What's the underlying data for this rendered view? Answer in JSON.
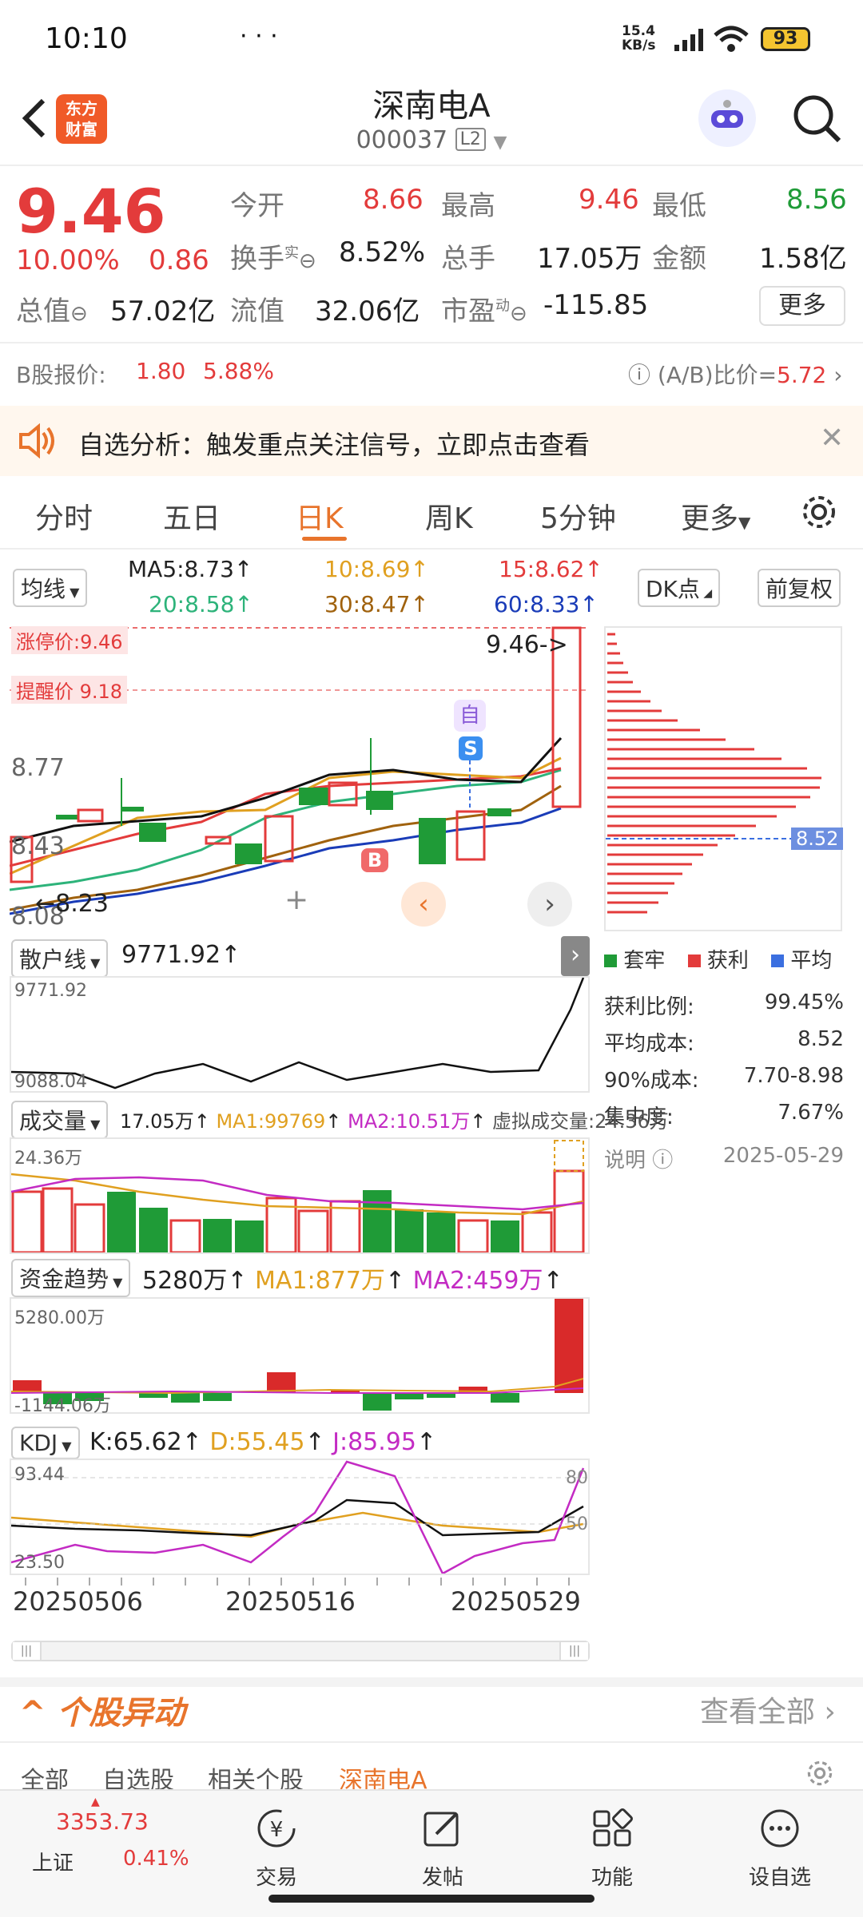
{
  "status": {
    "time": "10:10",
    "net_speed": "15.4 KB/s",
    "battery": "93"
  },
  "header": {
    "title": "深南电A",
    "code": "000037",
    "level": "L2",
    "logo_text": "东方 财富"
  },
  "quote": {
    "price": "9.46",
    "change_pct": "10.00%",
    "change": "0.86",
    "open_label": "今开",
    "open": "8.66",
    "high_label": "最高",
    "high": "9.46",
    "low_label": "最低",
    "low": "8.56",
    "turnover_label": "换手",
    "turnover_sup": "实",
    "turnover": "8.52%",
    "volume_label": "总手",
    "volume": "17.05万",
    "amount_label": "金额",
    "amount": "1.58亿",
    "mktcap_label": "总值",
    "mktcap": "57.02亿",
    "float_label": "流值",
    "float": "32.06亿",
    "pe_label": "市盈",
    "pe_sup": "动",
    "pe": "-115.85",
    "more": "更多"
  },
  "bshare": {
    "label": "B股报价:",
    "price": "1.80",
    "pct": "5.88%",
    "ratio_label": "(A/B)比价=",
    "ratio": "5.72"
  },
  "notice": {
    "text": "自选分析：触发重点关注信号，立即点击查看"
  },
  "tabs": [
    "分时",
    "五日",
    "日K",
    "周K",
    "5分钟",
    "更多"
  ],
  "ma_bar": {
    "selector": "均线",
    "ma5": "MA5:8.73",
    "ma10": "10:8.69",
    "ma15": "15:8.62",
    "ma20": "20:8.58",
    "ma30": "30:8.47",
    "ma60": "60:8.33",
    "dk": "DK点",
    "fq": "前复权"
  },
  "kline": {
    "limit_up": "涨停价:9.46",
    "alert": "提醒价 9.18",
    "y_top": "9.46",
    "y_mid": "8.77",
    "y_low": "8.43",
    "y_bot": "8.08",
    "price_tag": "9.46->",
    "low_tag": "8.23",
    "mark_zi": "自",
    "mark_s": "S",
    "mark_b": "B",
    "chip_tag": "8.52"
  },
  "chip_stats": {
    "legend": [
      "套牢",
      "获利",
      "平均"
    ],
    "rows": [
      {
        "label": "获利比例:",
        "value": "99.45%"
      },
      {
        "label": "平均成本:",
        "value": "8.52"
      },
      {
        "label": "90%成本:",
        "value": "7.70-8.98"
      },
      {
        "label": "集中度:",
        "value": "7.67%"
      }
    ],
    "note": "说明",
    "date": "2025-05-29"
  },
  "retail": {
    "label": "散户线",
    "value": "9771.92",
    "top": "9771.92",
    "bottom": "9088.04"
  },
  "volume_panel": {
    "label": "成交量",
    "value": "17.05万",
    "ma1": "MA1:99769",
    "ma2": "MA2:10.51万",
    "virtual": "虚拟成交量:24.36万",
    "top": "24.36万"
  },
  "fund_panel": {
    "label": "资金趋势",
    "value": "5280万",
    "ma1": "MA1:877万",
    "ma2": "MA2:459万",
    "top": "5280.00万",
    "bottom": "-1144.06万"
  },
  "kdj_panel": {
    "label": "KDJ",
    "k": "K:65.62",
    "d": "D:55.45",
    "j": "J:85.95",
    "top": "93.44",
    "bottom": "23.50",
    "r80": "80",
    "r50": "50"
  },
  "dates": [
    "20250506",
    "20250516",
    "20250529"
  ],
  "abnormal": {
    "title": "个股异动",
    "view_all": "查看全部"
  },
  "filter_tabs": [
    "全部",
    "自选股",
    "相关个股",
    "深南电A"
  ],
  "bottom": {
    "index_value": "3353.73",
    "index_name": "上证",
    "index_pct": "0.41%",
    "items": [
      "交易",
      "发帖",
      "功能",
      "设自选"
    ]
  },
  "colors": {
    "up": "#e33b3b",
    "down": "#1f9b37",
    "accent": "#e8742c"
  }
}
